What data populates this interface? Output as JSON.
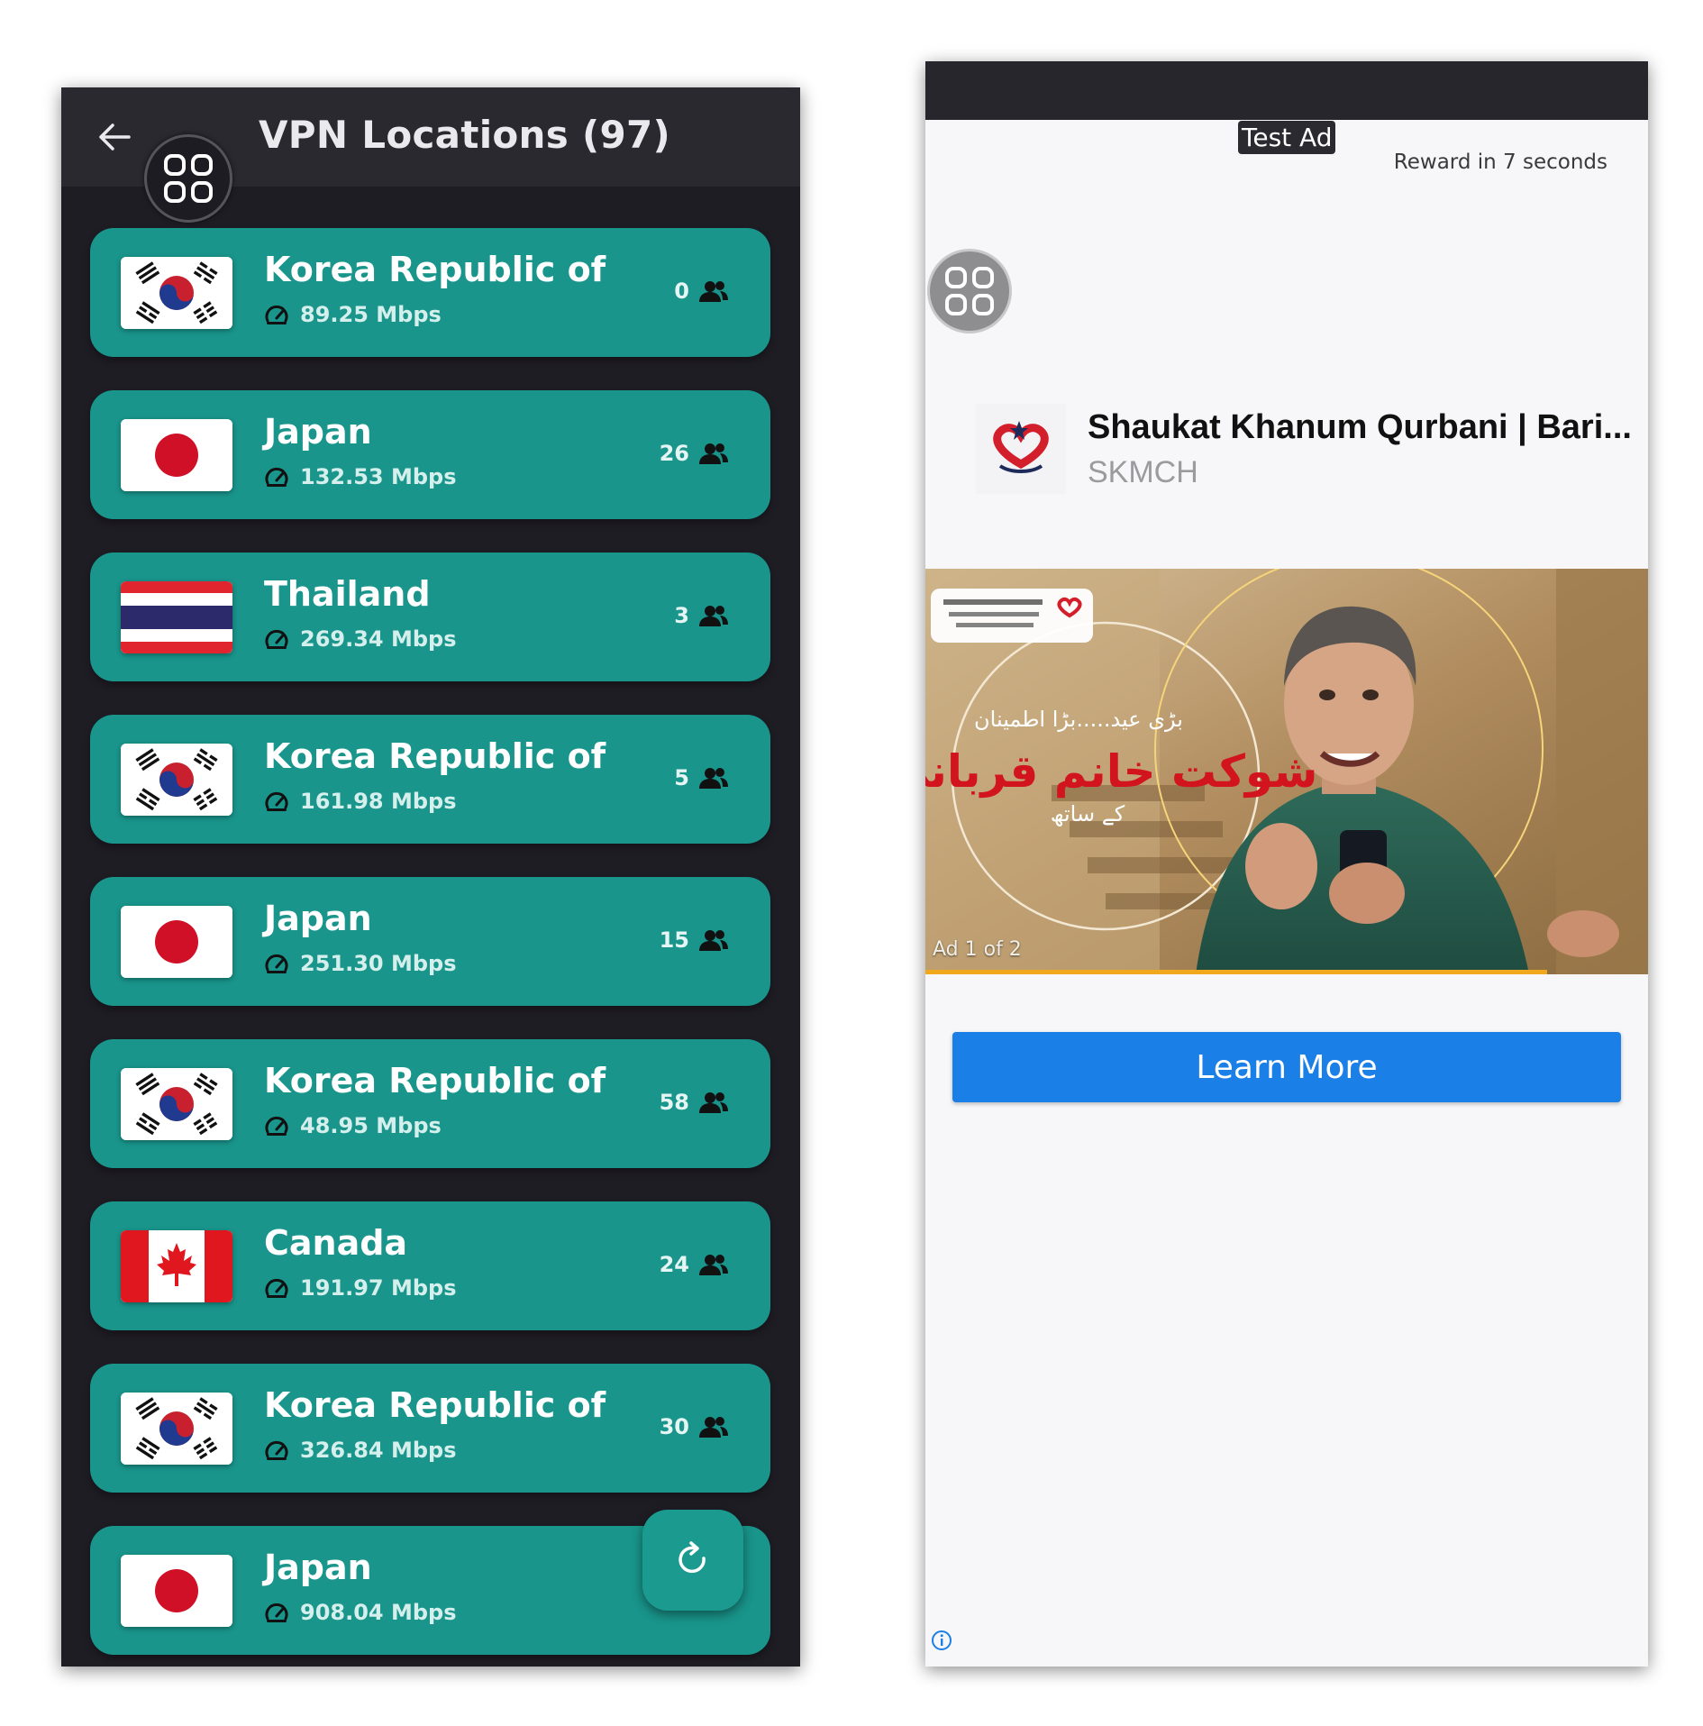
{
  "vpn_app": {
    "title": "VPN Locations (97)",
    "servers": [
      {
        "country": "Korea Republic of",
        "flag": "korea",
        "speed": "89.25 Mbps",
        "users": "0"
      },
      {
        "country": "Japan",
        "flag": "japan",
        "speed": "132.53 Mbps",
        "users": "26"
      },
      {
        "country": "Thailand",
        "flag": "thailand",
        "speed": "269.34 Mbps",
        "users": "3"
      },
      {
        "country": "Korea Republic of",
        "flag": "korea",
        "speed": "161.98 Mbps",
        "users": "5"
      },
      {
        "country": "Japan",
        "flag": "japan",
        "speed": "251.30 Mbps",
        "users": "15"
      },
      {
        "country": "Korea Republic of",
        "flag": "korea",
        "speed": "48.95 Mbps",
        "users": "58"
      },
      {
        "country": "Canada",
        "flag": "canada",
        "speed": "191.97 Mbps",
        "users": "24"
      },
      {
        "country": "Korea Republic of",
        "flag": "korea",
        "speed": "326.84 Mbps",
        "users": "30"
      },
      {
        "country": "Japan",
        "flag": "japan",
        "speed": "908.04 Mbps",
        "users": ""
      }
    ],
    "colors": {
      "card": "#19958b",
      "background": "#1f1d24",
      "appbar": "#2a2930"
    }
  },
  "ad": {
    "badge": "Test Ad",
    "reward": "Reward in 7 seconds",
    "title": "Shaukat Khanum Qurbani | Bari...",
    "advertiser": "SKMCH",
    "media_counter": "Ad 1 of 2",
    "cta": "Learn More",
    "urdu_line1": "بڑی عید.....بڑا اطمینان",
    "urdu_line2": "شوکت خانم قربانی",
    "urdu_line3": "کے ساتھ",
    "cta_color": "#1a7fe6"
  }
}
